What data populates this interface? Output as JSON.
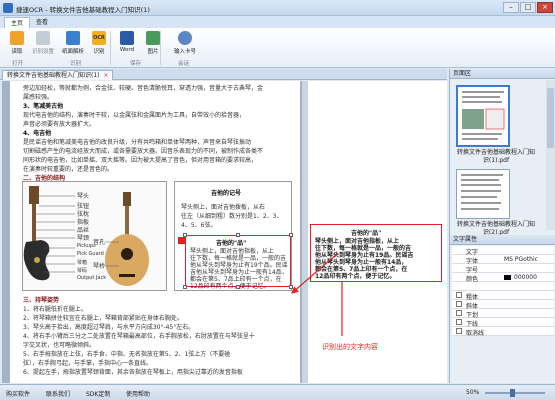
{
  "window": {
    "title": "捷速OCR - 转换文件吉他基础教程入门知识(1)",
    "minimize": "–",
    "maximize": "□",
    "close": "×"
  },
  "tabs": [
    {
      "label": "主页"
    },
    {
      "label": "查看"
    }
  ],
  "ribbon": {
    "buttons": [
      {
        "label": "读取",
        "icon": "read-icon"
      },
      {
        "label": "识别设置",
        "icon": "recognize-settings-icon"
      },
      {
        "label": "纸面解析",
        "icon": "page-analysis-icon"
      },
      {
        "label": "识别",
        "icon": "ocr-icon"
      },
      {
        "label": "Word",
        "icon": "word-icon"
      },
      {
        "label": "图片",
        "icon": "image-icon"
      },
      {
        "label": "输入卡号",
        "icon": "user-card-icon"
      }
    ],
    "groups": [
      {
        "label": "打开"
      },
      {
        "label": "识别"
      },
      {
        "label": "保存"
      },
      {
        "label": "会话"
      }
    ]
  },
  "document_tab": {
    "label": "转换文件吉他基础教程入门知识(1)"
  },
  "document_page": {
    "lines": [
      "旁边加轻松，等就都为例，合金弦、较硬。音色清脆悦耳，穿透力强，音量大于古典琴，金",
      "属感较强。",
      "3、笔减美古他",
      "现代电吉他的结构，演奏时干较，以金属弦和金属面片为工具，自带效小的拾音器，",
      "声音必须要有放大器扩大。",
      "4、电吉他",
      "是民谣吉他和笔减美电吉他的改良升级，分有共鸣箱和单体琴两种，声音来自琴弦振动",
      "切割磁感产生的电流经放大而成，或各需要放大器。因音乐表现力的不同，被制作成各类不",
      "同形状的电吉他，比如单摇、双大摇等。因为被大提高了音色，但对用音箱的要求较高，",
      "在演奏时较重要的，还是音色的。",
      "二、吉他的结构",
      "三、持琴姿势",
      "1、将右腿低折在腿上。",
      "2、将琴箱拼住较宜在右腿上，琴箱背部紧贴在身体右胸处。",
      "3、琴头高于拾出，高度超过琴肩，与水平方向成30°-45°左右。",
      "4、将右手小臂后三分之二处放置在琴箱最高部位，右手腕放松，右肘放置在与琴弦呈十",
      "字交叉状，也可略微倾斜。",
      "5、右手拇指放在上弦，右手食、中指、无名指放在第5、2、1弦上方（不要碰",
      "弦），右手腕弓起，与手掌，手指中心一条直线。",
      "6、提起左手，拇指放置琴颈背面，其余各指放在琴板上，用指尖过靠近的发音指板"
    ],
    "guitar_labels": [
      "琴头",
      "弦钮",
      "弦枕",
      "指板",
      "品丝",
      "琴颈",
      "音孔",
      "琴桥",
      "Pickups",
      "Pick Guard",
      "琴箱",
      "琴码",
      "Output Jack"
    ],
    "panel_title": "吉他的记号",
    "panel_lines": [
      "琴头侧上，面对吉他拨板，从右",
      "往左（从细到粗）数分别是1、2、3、",
      "4、5、6弦。"
    ],
    "selected_title": "吉他的\"品\"",
    "selected_lines": [
      "琴头侧上，面对吉他指板，从上",
      "往下数，每一格就是一品，一般的吉",
      "他从琴头到琴身为止有19个品。民谣",
      "吉他从琴头到琴身为止一般有14品，",
      "都会在第5、7品上印有一个点，在",
      "12品印有两个点，便于记忆。"
    ]
  },
  "text_pane": {
    "ocr_lines": [
      "吉他的\"品\"",
      "琴头侧上，面对吉他指板，从上",
      "往下数，每一格就是一品，一般的吉",
      "他从琴头到琴身为止有19品。民谣吉",
      "他从琴头到琴身为止一般有14品，",
      "都会在第5、7品上印有一个点，在",
      "12品印有两个点，便于记忆。"
    ],
    "callout": "识别出的文字内容"
  },
  "page_panel": {
    "title": "页面区",
    "thumbs": [
      {
        "label": "转换文件吉他基础教程入门知识(1).pdf"
      },
      {
        "label": "转换文件吉他基础教程入门知识(2).pdf"
      }
    ]
  },
  "text_props": {
    "title": "文字属性",
    "rows": [
      {
        "key": "文字",
        "value": ""
      },
      {
        "key": "字体",
        "value": "MS PGothic"
      },
      {
        "key": "字号",
        "value": ""
      },
      {
        "key": "颜色",
        "value": "000000"
      },
      {
        "key": "",
        "value": ""
      },
      {
        "key": "粗体",
        "value": ""
      },
      {
        "key": "斜体",
        "value": ""
      },
      {
        "key": "下划",
        "value": ""
      },
      {
        "key": "下线",
        "value": ""
      },
      {
        "key": "取消线",
        "value": ""
      }
    ]
  },
  "statusbar": {
    "items": [
      "购买软件",
      "联系我们",
      "SDK定制",
      "使用帮助"
    ],
    "zoom": "50%"
  },
  "colors": {
    "accent": "#3d7ad6",
    "highlight": "#e02222"
  }
}
